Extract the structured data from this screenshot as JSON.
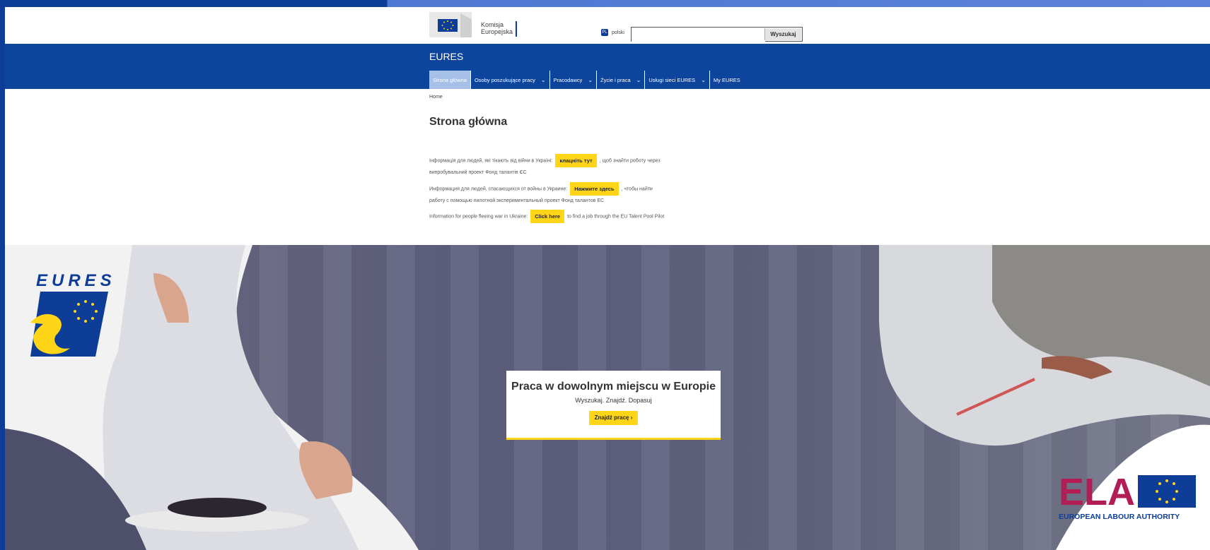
{
  "header": {
    "ec_logo_line1": "Komisja",
    "ec_logo_line2": "Europejska",
    "language": "polski",
    "search_value": "",
    "search_button": "Wyszukaj"
  },
  "site": {
    "name": "EURES"
  },
  "nav": [
    {
      "label": "Strona główna",
      "has_menu": false
    },
    {
      "label": "Osoby poszukujące pracy",
      "has_menu": true
    },
    {
      "label": "Pracodawcy",
      "has_menu": true
    },
    {
      "label": "Życie i praca",
      "has_menu": true
    },
    {
      "label": "Usługi sieci EURES",
      "has_menu": true
    },
    {
      "label": "My EURES",
      "has_menu": false
    }
  ],
  "breadcrumb": "Home",
  "page_title": "Strona główna",
  "notices": [
    {
      "before": "Інформація для людей, які тікають від війни в Україні:",
      "button": "клацніть тут",
      "after": ", щоб знайти роботу через випробувальний проект Фонд талантів ЄС"
    },
    {
      "before": "Информация для людей, спасающихся от войны в Украине:",
      "button": "Нажмите здесь",
      "after": ", чтобы найти работу с помощью пилотной экспериментальный проект Фонд талантов ЕС"
    },
    {
      "before": "Information for people fleeing war in Ukraine:",
      "button": "Click here",
      "after": "to find a job through the EU Talent Pool Pilot"
    }
  ],
  "hero": {
    "title": "Praca w dowolnym miejscu w Europie",
    "subtitle": "Wyszukaj. Znajdź. Dopasuj",
    "button": "Znajdź pracę"
  },
  "logos": {
    "eures": "EURES",
    "ela_short": "ELA",
    "ela_full": "EUROPEAN LABOUR AUTHORITY"
  },
  "colors": {
    "brand_blue": "#0d449c",
    "accent_yellow": "#ffd617"
  }
}
